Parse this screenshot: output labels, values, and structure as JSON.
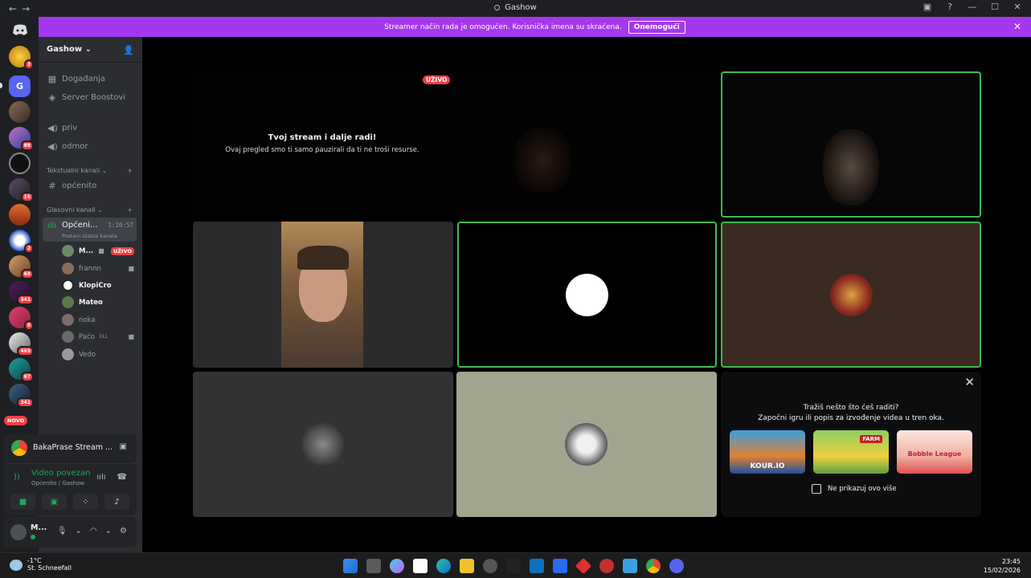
{
  "window": {
    "title": "Gashow",
    "back": "←",
    "forward": "→"
  },
  "banner": {
    "text": "Streamer način rada je omogućen. Korisnička imena su skraćena.",
    "button": "Onemogući"
  },
  "rail": {
    "novo": "NOVO",
    "badges": [
      "3",
      "88",
      "16",
      "2",
      "68",
      "341",
      "8",
      "469",
      "67",
      "341"
    ]
  },
  "sidebar": {
    "server_name": "Gashow",
    "items": [
      {
        "label": "Događanja"
      },
      {
        "label": "Server Boostovi"
      },
      {
        "label": "priv"
      },
      {
        "label": "odmor"
      }
    ],
    "text_category": "Tekstualni kanali",
    "text_channel": "općenito",
    "voice_category": "Glasovni kanali",
    "active_voice": {
      "name": "Općeni...",
      "time": "1:10:57",
      "status": "Postavi status kanala"
    },
    "voice_users": [
      {
        "name": "M...",
        "live": "UŽIVO"
      },
      {
        "name": "frannn"
      },
      {
        "name": "KlopiCro"
      },
      {
        "name": "Mateo"
      },
      {
        "name": "noka"
      },
      {
        "name": "Paćo",
        "extra": "ELL"
      },
      {
        "name": "Vedo"
      }
    ]
  },
  "stream_panel": {
    "title": "BakaPrase Stream ..."
  },
  "voice_panel": {
    "status": "Video povezan",
    "location": "Općenito / Gashow"
  },
  "user_panel": {
    "name": "M..."
  },
  "stage": {
    "live_badge": "UŽIVO",
    "notice_title": "Tvoj stream i dalje radi!",
    "notice_sub": "Ovaj pregled smo ti samo pauzirali da ti ne troši resurse."
  },
  "activity": {
    "line1": "Tražiš nešto što ćeš raditi?",
    "line2": "Započni igru ili popis za izvođenje videa u tren oka.",
    "games": [
      "KOUR.IO",
      "FARM",
      "Bobble League"
    ],
    "checkbox": "Ne prikazuj ovo više"
  },
  "taskbar": {
    "temp": "-1°C",
    "weather": "St. Schneefall",
    "time": "23:45",
    "date": "15/02/2026"
  },
  "colors": {
    "accent_banner": "#a438f0",
    "speaking": "#3fb94f",
    "live": "#f23f43"
  }
}
